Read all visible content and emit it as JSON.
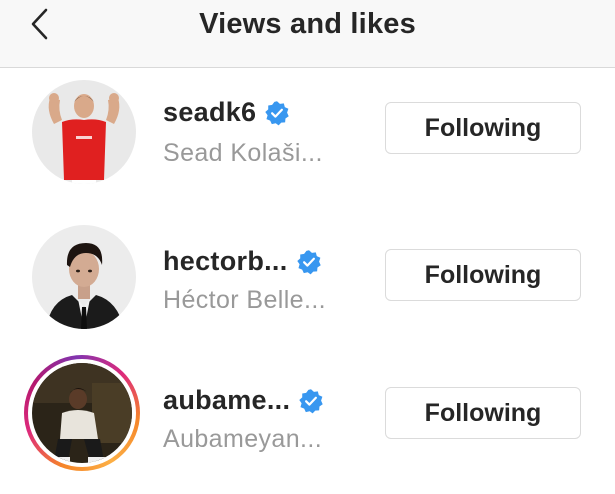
{
  "header": {
    "title": "Views and likes",
    "back_icon": "chevron-left-icon"
  },
  "colors": {
    "verified_blue": "#3897f0",
    "text_primary": "#262626",
    "text_secondary": "#999999",
    "button_border": "#dbdbdb",
    "header_bg": "#f8f8f8"
  },
  "users": [
    {
      "username": "seadk6",
      "full_name": "Sead Kolaši...",
      "verified": true,
      "button_label": "Following",
      "has_story_ring": false
    },
    {
      "username": "hectorb...",
      "full_name": "Héctor Belle...",
      "verified": true,
      "button_label": "Following",
      "has_story_ring": false
    },
    {
      "username": "aubame...",
      "full_name": "Aubameyan...",
      "verified": true,
      "button_label": "Following",
      "has_story_ring": true
    }
  ]
}
